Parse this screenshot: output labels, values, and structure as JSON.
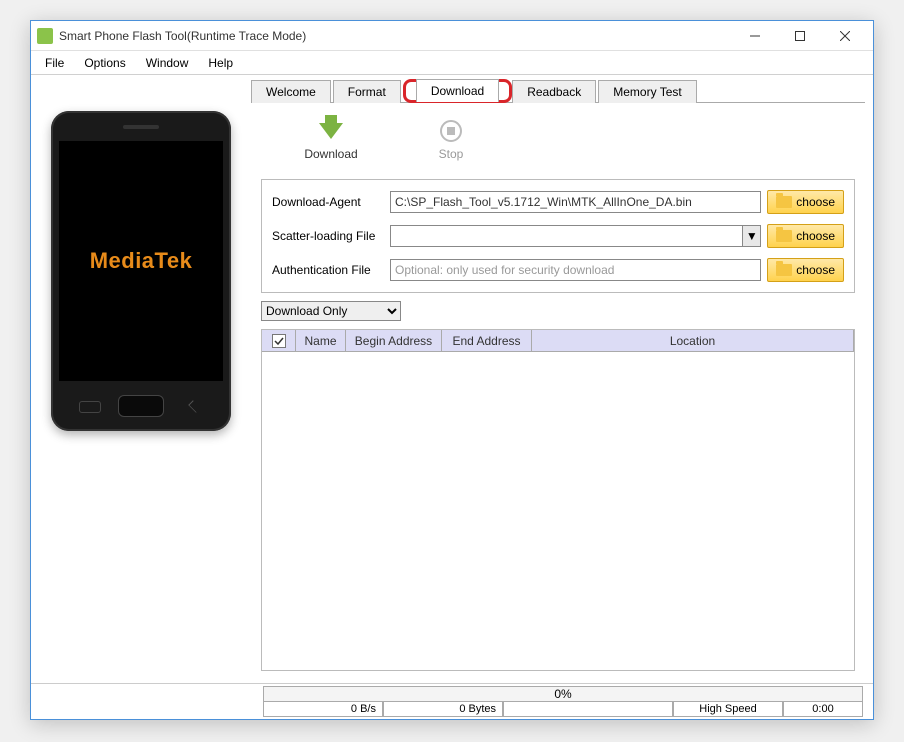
{
  "window": {
    "title": "Smart Phone Flash Tool(Runtime Trace Mode)"
  },
  "menubar": [
    "File",
    "Options",
    "Window",
    "Help"
  ],
  "left": {
    "brand": "MediaTek"
  },
  "tabs": {
    "items": [
      "Welcome",
      "Format",
      "Download",
      "Readback",
      "Memory Test"
    ],
    "active": "Download"
  },
  "toolbar": {
    "download": "Download",
    "stop": "Stop"
  },
  "fields": {
    "download_agent": {
      "label": "Download-Agent",
      "value": "C:\\SP_Flash_Tool_v5.1712_Win\\MTK_AllInOne_DA.bin",
      "choose": "choose"
    },
    "scatter": {
      "label": "Scatter-loading File",
      "value": "",
      "choose": "choose"
    },
    "auth": {
      "label": "Authentication File",
      "value": "",
      "placeholder": "Optional: only used for security download",
      "choose": "choose"
    }
  },
  "mode_dropdown": {
    "value": "Download Only"
  },
  "grid": {
    "headers": {
      "name": "Name",
      "begin": "Begin Address",
      "end": "End Address",
      "location": "Location"
    }
  },
  "footer": {
    "progress": "0%",
    "rate": "0 B/s",
    "bytes": "0 Bytes",
    "conn": "High Speed",
    "time": "0:00"
  }
}
